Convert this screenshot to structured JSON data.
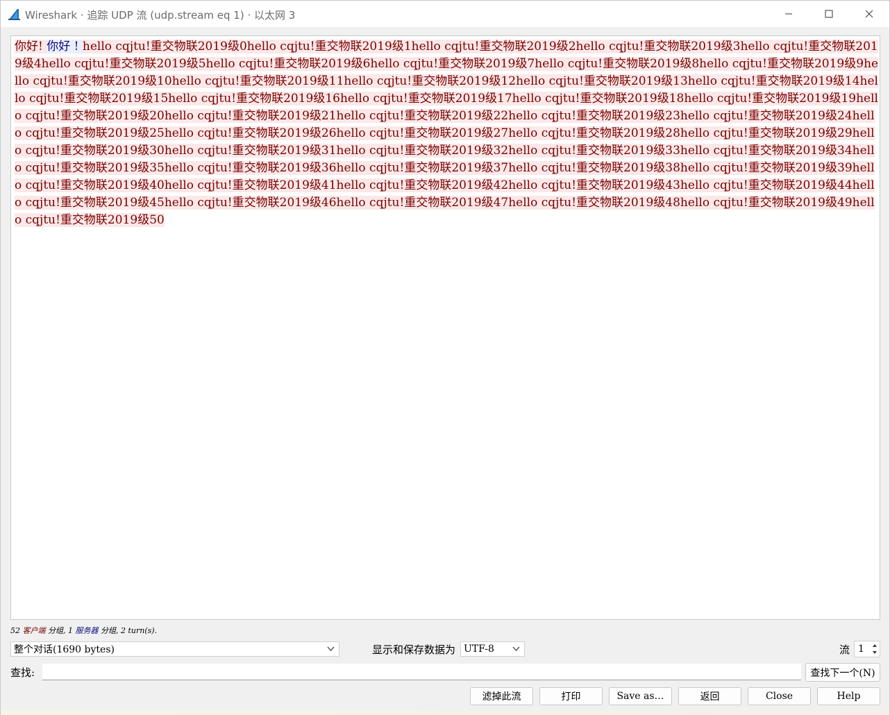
{
  "window": {
    "title": "Wireshark · 追踪 UDP 流 (udp.stream eq 1) · 以太网 3",
    "icon": "wireshark-fin-icon",
    "accent_color": "#1f6fb5"
  },
  "stream": {
    "client_color": "#7a0000",
    "client_bg": "#fbe8e8",
    "server_color": "#0a0a80",
    "server_bg": "#ebeefa",
    "segments": [
      {
        "side": "client",
        "text": "你好! "
      },
      {
        "side": "server",
        "text": "你好 ! "
      },
      {
        "side": "client",
        "text": "hello cqjtu!重交物联2019级0hello cqjtu!重交物联2019级1hello cqjtu!重交物联2019级2hello cqjtu!重交物联2019级3hello cqjtu!重交物联2019级4hello cqjtu!重交物联2019级5hello cqjtu!重交物联2019级6hello cqjtu!重交物联2019级7hello cqjtu!重交物联2019级8hello cqjtu!重交物联2019级9hello cqjtu!重交物联2019级10hello cqjtu!重交物联2019级11hello cqjtu!重交物联2019级12hello cqjtu!重交物联2019级13hello cqjtu!重交物联2019级14hello cqjtu!重交物联2019级15hello cqjtu!重交物联2019级16hello cqjtu!重交物联2019级17hello cqjtu!重交物联2019级18hello cqjtu!重交物联2019级19hello cqjtu!重交物联2019级20hello cqjtu!重交物联2019级21hello cqjtu!重交物联2019级22hello cqjtu!重交物联2019级23hello cqjtu!重交物联2019级24hello cqjtu!重交物联2019级25hello cqjtu!重交物联2019级26hello cqjtu!重交物联2019级27hello cqjtu!重交物联2019级28hello cqjtu!重交物联2019级29hello cqjtu!重交物联2019级30hello cqjtu!重交物联2019级31hello cqjtu!重交物联2019级32hello cqjtu!重交物联2019级33hello cqjtu!重交物联2019级34hello cqjtu!重交物联2019级35hello cqjtu!重交物联2019级36hello cqjtu!重交物联2019级37hello cqjtu!重交物联2019级38hello cqjtu!重交物联2019级39hello cqjtu!重交物联2019级40hello cqjtu!重交物联2019级41hello cqjtu!重交物联2019级42hello cqjtu!重交物联2019级43hello cqjtu!重交物联2019级44hello cqjtu!重交物联2019级45hello cqjtu!重交物联2019级46hello cqjtu!重交物联2019级47hello cqjtu!重交物联2019级48hello cqjtu!重交物联2019级49hello cqjtu!重交物联2019级50"
      }
    ]
  },
  "summary": {
    "client_count": "52",
    "client_word": "客户端",
    "client_suffix": "分组,",
    "server_count": "1",
    "server_word": "服务器",
    "server_suffix": "分组,",
    "turns": "2 turn(s)."
  },
  "controls": {
    "conversation_select": "整个对话(1690 bytes)",
    "show_save_label": "显示和保存数据为",
    "encoding_select": "UTF-8",
    "stream_label": "流",
    "stream_number": "1",
    "find_label": "查找:",
    "find_value": "",
    "find_next": "查找下一个(N)"
  },
  "buttons": {
    "filter_out": "滤掉此流",
    "print": "打印",
    "save_as": "Save as…",
    "back": "返回",
    "close": "Close",
    "help": "Help"
  }
}
